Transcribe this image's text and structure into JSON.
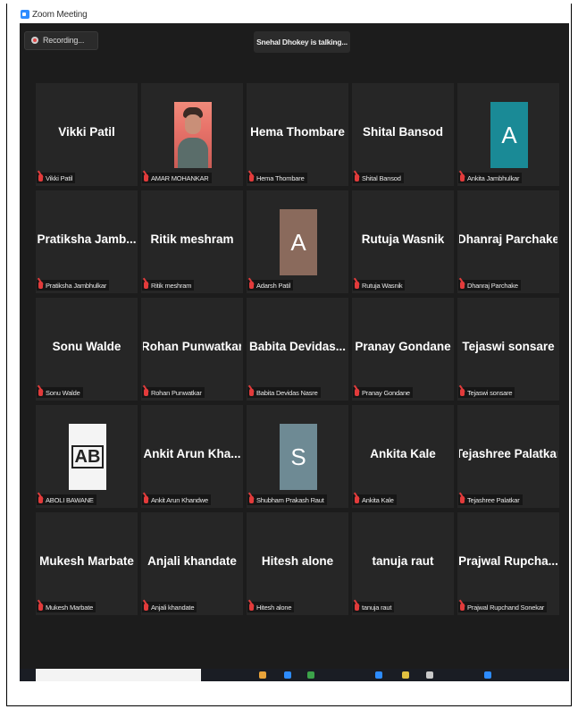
{
  "window": {
    "title": "Zoom Meeting"
  },
  "recording": {
    "label": "Recording..."
  },
  "active_speaker": {
    "text": "Snehal Dhokey is talking..."
  },
  "tiles": [
    {
      "display": "Vikki Patil",
      "label": "Vikki Patil",
      "avatar": "none"
    },
    {
      "display": "",
      "label": "AMAR MOHANKAR",
      "avatar": "photo"
    },
    {
      "display": "Hema Thombare",
      "label": "Hema Thombare",
      "avatar": "none"
    },
    {
      "display": "Shital Bansod",
      "label": "Shital Bansod",
      "avatar": "none"
    },
    {
      "display": "A",
      "label": "Ankita Jambhulkar",
      "avatar": "letter",
      "avatar_color": "#1a8a96"
    },
    {
      "display": "Pratiksha  Jamb...",
      "label": "Pratiksha Jambhulkar",
      "avatar": "none"
    },
    {
      "display": "Ritik meshram",
      "label": "Ritik meshram",
      "avatar": "none"
    },
    {
      "display": "A",
      "label": "Adarsh Patil",
      "avatar": "letter",
      "avatar_color": "#8a6a5c"
    },
    {
      "display": "Rutuja Wasnik",
      "label": "Rutuja Wasnik",
      "avatar": "none"
    },
    {
      "display": "Dhanraj Parchake",
      "label": "Dhanraj Parchake",
      "avatar": "none"
    },
    {
      "display": "Sonu Walde",
      "label": "Sonu Walde",
      "avatar": "none"
    },
    {
      "display": "Rohan Punwatkar",
      "label": "Rohan Punwatkar",
      "avatar": "none"
    },
    {
      "display": "Babita  Devidas...",
      "label": "Babita Devidas Nasre",
      "avatar": "none"
    },
    {
      "display": "Pranay Gondane",
      "label": "Pranay Gondane",
      "avatar": "none"
    },
    {
      "display": "Tejaswi sonsare",
      "label": "Tejaswi sonsare",
      "avatar": "none"
    },
    {
      "display": "AB",
      "label": "ABOLI BAWANE",
      "avatar": "logo"
    },
    {
      "display": "Ankit  Arun  Kha...",
      "label": "Ankit Arun Khandwe",
      "avatar": "none"
    },
    {
      "display": "S",
      "label": "Shubham Prakash Raut",
      "avatar": "letter",
      "avatar_color": "#6e8a94"
    },
    {
      "display": "Ankita Kale",
      "label": "Ankita Kale",
      "avatar": "none"
    },
    {
      "display": "Tejashree Palatkar",
      "label": "Tejashree Palatkar",
      "avatar": "none"
    },
    {
      "display": "Mukesh Marbate",
      "label": "Mukesh Marbate",
      "avatar": "none"
    },
    {
      "display": "Anjali khandate",
      "label": "Anjali khandate",
      "avatar": "none"
    },
    {
      "display": "Hitesh alone",
      "label": "Hitesh alone",
      "avatar": "none"
    },
    {
      "display": "tanuja raut",
      "label": "tanuja raut",
      "avatar": "none"
    },
    {
      "display": "Prajwal  Rupcha...",
      "label": "Prajwal Rupchand Sonekar",
      "avatar": "none"
    }
  ]
}
